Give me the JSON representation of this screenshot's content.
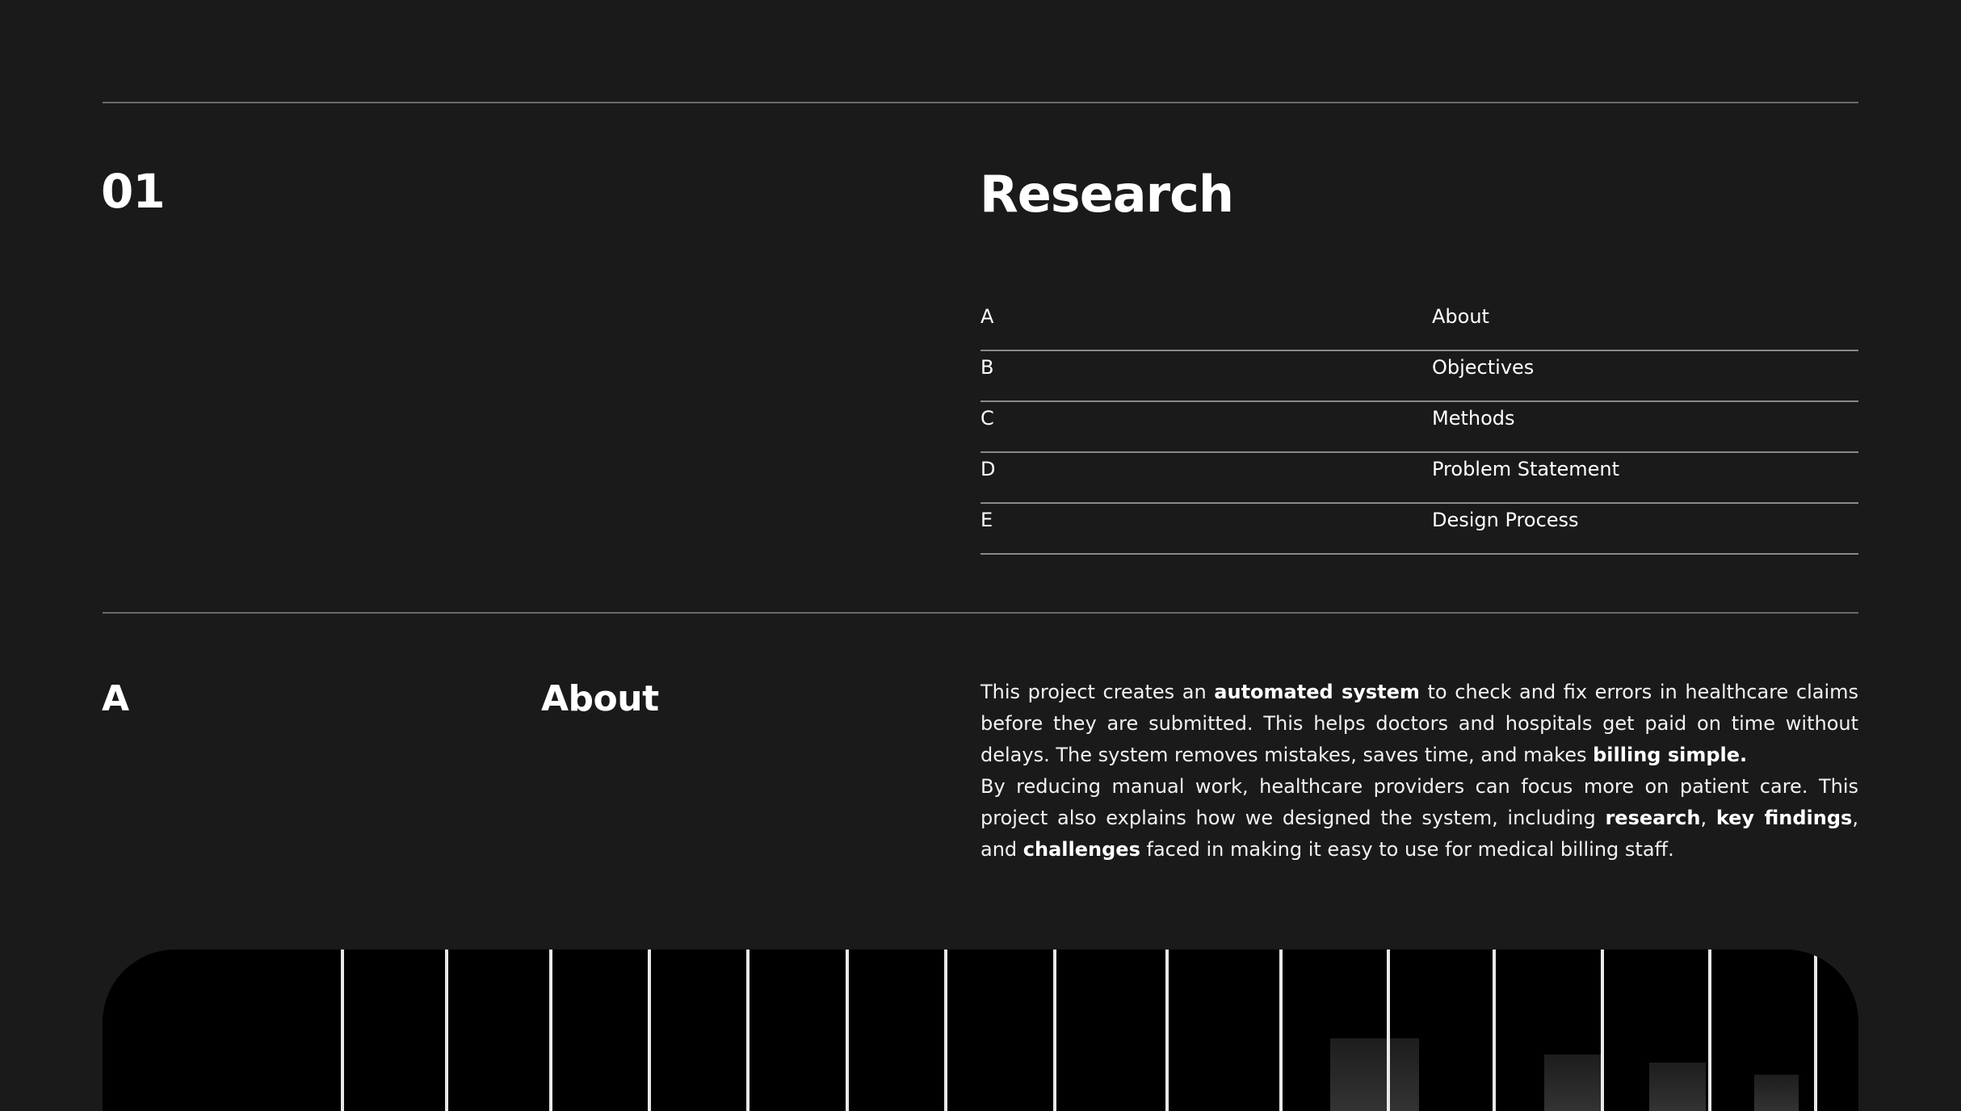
{
  "section": {
    "number": "01",
    "title": "Research"
  },
  "toc": [
    {
      "letter": "A",
      "label": "About"
    },
    {
      "letter": "B",
      "label": "Objectives"
    },
    {
      "letter": "C",
      "label": "Methods"
    },
    {
      "letter": "D",
      "label": "Problem Statement"
    },
    {
      "letter": "E",
      "label": "Design Process"
    }
  ],
  "about": {
    "letter": "A",
    "title": "About",
    "p1": [
      "This project creates an ",
      "automated system",
      " to check and fix errors in healthcare claims before they are submitted. This helps doctors and hospitals get paid on time without delays. The system removes mistakes, saves time, and makes ",
      "billing simple."
    ],
    "p2": [
      "By reducing manual work, healthcare providers can focus more on patient care. This project also explains how we designed the system, including ",
      "research",
      ", ",
      "key findings",
      ", and ",
      "challenges",
      " faced in making it easy to use for medical billing staff."
    ]
  },
  "colors": {
    "background": "#1a1a1a",
    "text": "#ffffff",
    "divider": "#6a6a6a",
    "hero_background": "#000000"
  }
}
